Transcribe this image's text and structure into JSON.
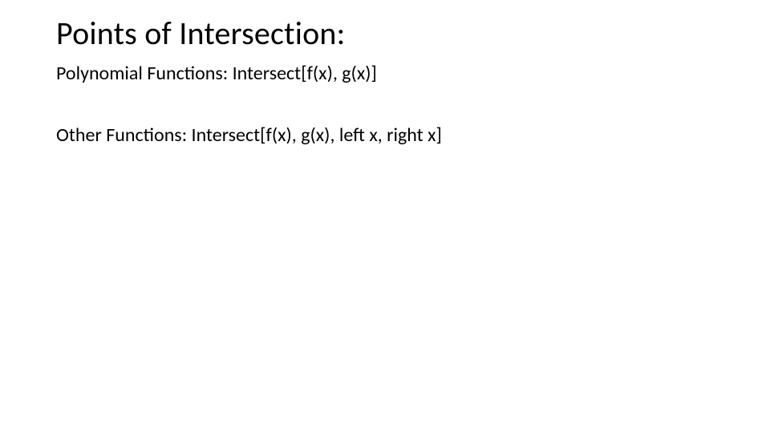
{
  "slide": {
    "title": "Points of Intersection:",
    "line1": "Polynomial Functions: Intersect[f(x), g(x)]",
    "line2": "Other Functions: Intersect[f(x), g(x), left x, right x]"
  }
}
